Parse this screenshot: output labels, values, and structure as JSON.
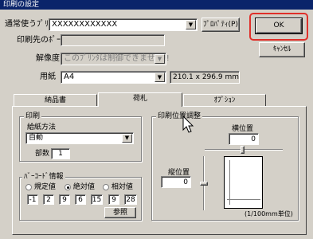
{
  "window": {
    "title": "印刷の設定"
  },
  "printer": {
    "normal_label": "通常使うﾌﾟﾘﾝﾀ",
    "normal_value": "XXXXXXXXXXXX",
    "port_label": "印刷先のﾎﾟｰﾄ",
    "port_value": "",
    "resolution_label": "解像度",
    "resolution_value": "このﾌﾟﾘﾝﾀは制御できません!!",
    "paper_label": "用紙",
    "paper_value": "A4",
    "paper_size": "210.1 x 296.9 mm",
    "properties_label": "ﾌﾟﾛﾊﾟﾃｨ(P)"
  },
  "buttons": {
    "ok_label": "OK",
    "cancel_label": "ｷｬﾝｾﾙ",
    "browse_label": "参照"
  },
  "tabs": [
    {
      "label": "納品書",
      "active": false
    },
    {
      "label": "荷札",
      "active": true
    },
    {
      "label": "ｵﾌﾟｼｮﾝ",
      "active": false
    }
  ],
  "print_group": {
    "title": "印刷",
    "feed_label": "給紙方法",
    "feed_value": "自動",
    "copies_label": "部数",
    "copies_value": "1"
  },
  "barcode_group": {
    "title": "ﾊﾞｰｺｰﾄﾞ情報",
    "radios": [
      {
        "label": "規定値",
        "checked": false
      },
      {
        "label": "絶対値",
        "checked": true
      },
      {
        "label": "相対値",
        "checked": false
      }
    ],
    "values": [
      "-1",
      "2",
      "9",
      "6",
      "15",
      "9",
      "28"
    ]
  },
  "position_group": {
    "title": "印刷位置調整",
    "horizontal_label": "横位置",
    "horizontal_value": "0",
    "vertical_label": "縦位置",
    "vertical_value": "0",
    "unit_label": "(1/100mm単位)"
  },
  "colors": {
    "highlight": "#e0302a",
    "titlebar": "#0a246a",
    "face": "#d4d0c8"
  }
}
